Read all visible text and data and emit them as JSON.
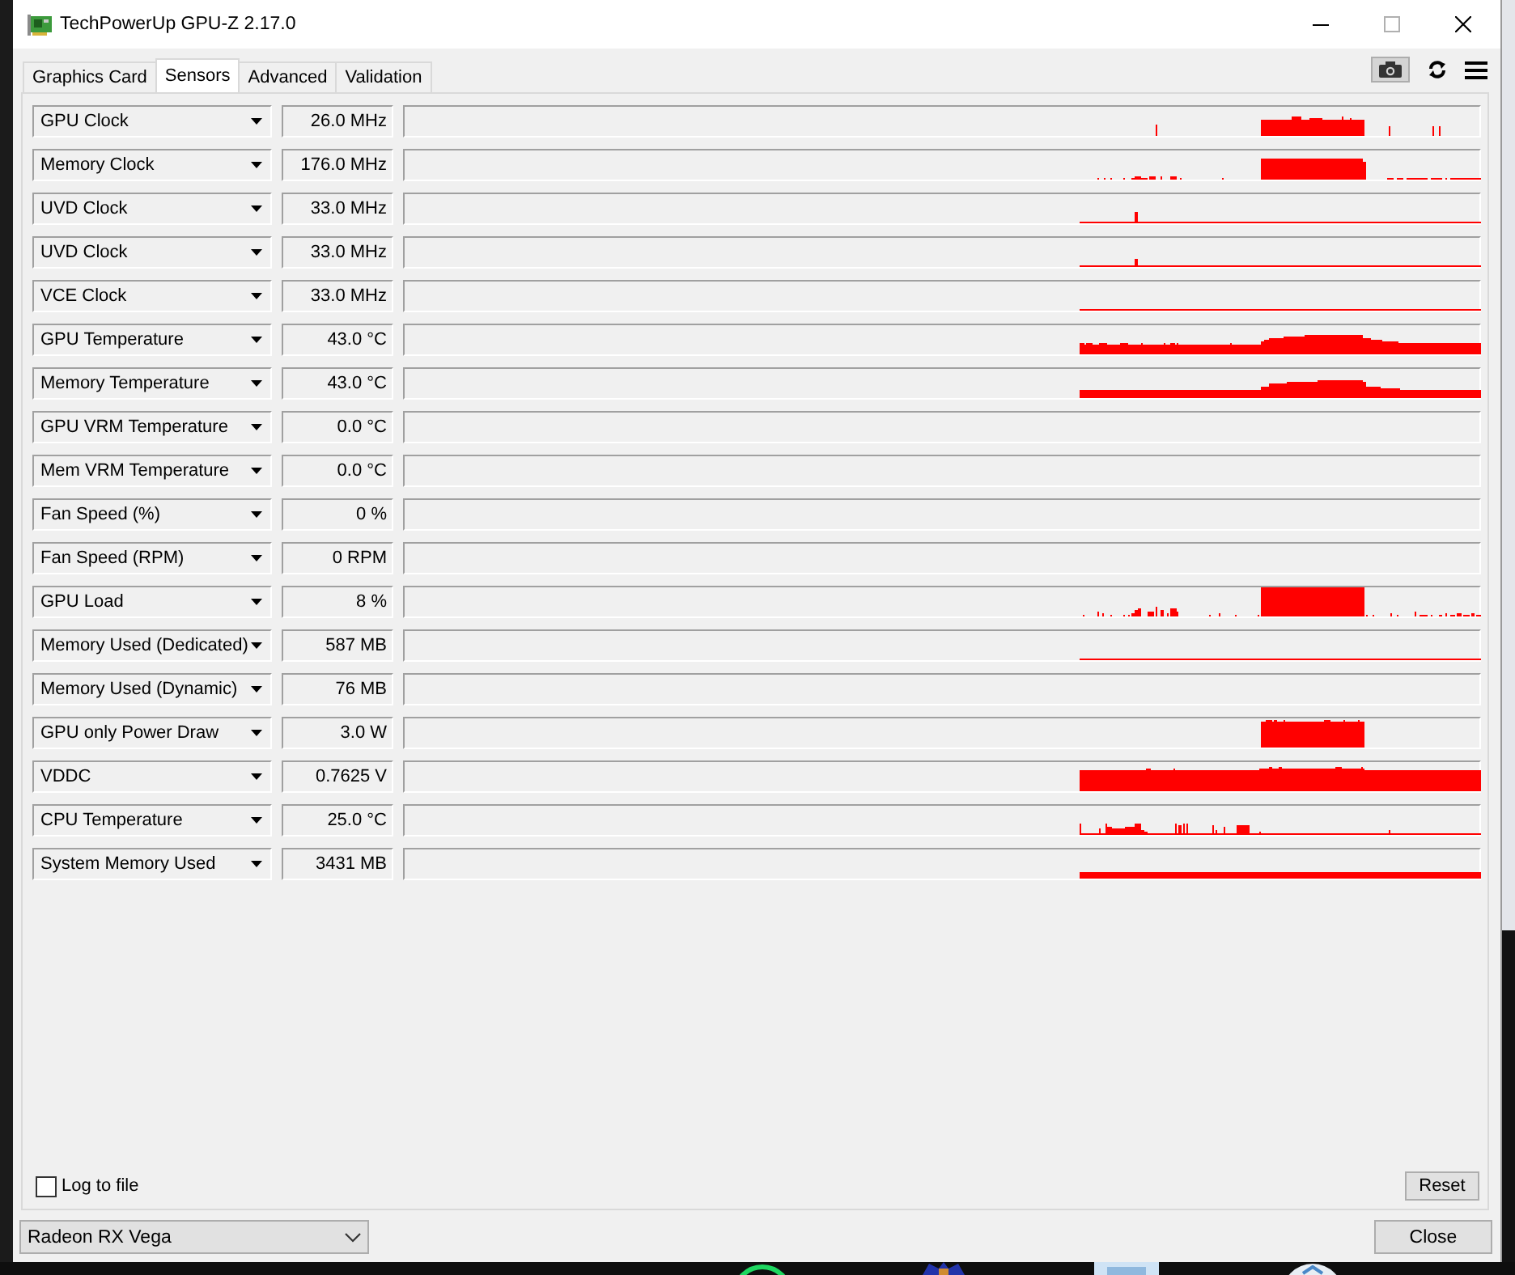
{
  "window": {
    "title": "TechPowerUp GPU-Z 2.17.0"
  },
  "tabs": [
    {
      "label": "Graphics Card",
      "selected": false
    },
    {
      "label": "Sensors",
      "selected": true
    },
    {
      "label": "Advanced",
      "selected": false
    },
    {
      "label": "Validation",
      "selected": false
    }
  ],
  "sensors": [
    {
      "name": "GPU Clock",
      "value": "26.0 MHz"
    },
    {
      "name": "Memory Clock",
      "value": "176.0 MHz"
    },
    {
      "name": "UVD Clock",
      "value": "33.0 MHz"
    },
    {
      "name": "UVD Clock",
      "value": "33.0 MHz"
    },
    {
      "name": "VCE Clock",
      "value": "33.0 MHz"
    },
    {
      "name": "GPU Temperature",
      "value": "43.0 °C"
    },
    {
      "name": "Memory Temperature",
      "value": "43.0 °C"
    },
    {
      "name": "GPU VRM Temperature",
      "value": "0.0 °C"
    },
    {
      "name": "Mem VRM Temperature",
      "value": "0.0 °C"
    },
    {
      "name": "Fan Speed (%)",
      "value": "0 %"
    },
    {
      "name": "Fan Speed (RPM)",
      "value": "0 RPM"
    },
    {
      "name": "GPU Load",
      "value": "8 %"
    },
    {
      "name": "Memory Used (Dedicated)",
      "value": "587 MB"
    },
    {
      "name": "Memory Used (Dynamic)",
      "value": "76 MB"
    },
    {
      "name": "GPU only Power Draw",
      "value": "3.0 W"
    },
    {
      "name": "VDDC",
      "value": "0.7625 V"
    },
    {
      "name": "CPU Temperature",
      "value": "25.0 °C"
    },
    {
      "name": "System Memory Used",
      "value": "3431 MB"
    }
  ],
  "log_to_file": {
    "label": "Log to file",
    "checked": false
  },
  "reset_button": "Reset",
  "device_select": {
    "value": "Radeon RX Vega"
  },
  "close_button": "Close"
}
